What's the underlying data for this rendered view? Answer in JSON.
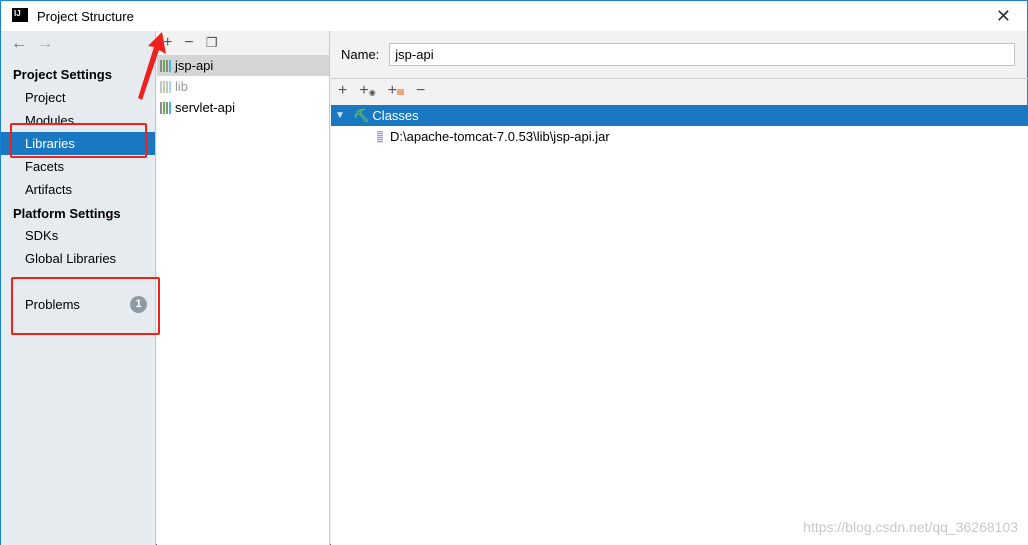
{
  "window": {
    "title": "Project Structure",
    "logo": "IJ"
  },
  "sidebar": {
    "project_settings": "Project Settings",
    "items": [
      {
        "label": "Project"
      },
      {
        "label": "Modules"
      },
      {
        "label": "Libraries",
        "selected": true
      },
      {
        "label": "Facets"
      },
      {
        "label": "Artifacts"
      }
    ],
    "platform_settings": "Platform Settings",
    "platform_items": [
      {
        "label": "SDKs"
      },
      {
        "label": "Global Libraries"
      }
    ],
    "problems": {
      "label": "Problems",
      "count": "1"
    }
  },
  "libraries": {
    "items": [
      {
        "label": "jsp-api",
        "selected": true
      },
      {
        "label": "lib",
        "dimmed": true
      },
      {
        "label": "servlet-api"
      }
    ]
  },
  "detail": {
    "name_label": "Name:",
    "name_value": "jsp-api",
    "tree": {
      "root": "Classes",
      "children": [
        "D:\\apache-tomcat-7.0.53\\lib\\jsp-api.jar"
      ]
    }
  },
  "watermark": "https://blog.csdn.net/qq_36268103",
  "colors": {
    "selection": "#1a78c2",
    "annotation": "#f0201a"
  }
}
